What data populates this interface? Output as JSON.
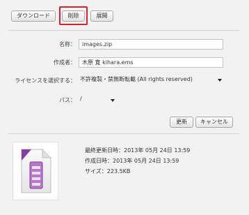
{
  "toolbar": {
    "download_label": "ダウンロード",
    "delete_label": "削除",
    "expand_label": "展開"
  },
  "form": {
    "name_label": "名称：",
    "name_value": "images.zip",
    "author_label": "作成者：",
    "author_value": "木原 寛 kihara.ems",
    "license_label": "ライセンスを選択する：",
    "license_value": "不許複製・禁無断転載 (All rights reserved)",
    "path_label": "パス：",
    "path_value": "/"
  },
  "actions": {
    "update_label": "更新",
    "cancel_label": "キャンセル"
  },
  "file_info": {
    "modified": "最終更新日時：2013年 05月 24日 13:59",
    "created": "作成日時：2013年 05月 24日 13:59",
    "size": "サイズ：223.5KB"
  },
  "colors": {
    "highlight": "#d9242b",
    "zip_icon_accent": "#8a3aa6"
  },
  "icons": {
    "file_thumbnail": "zip-archive-icon"
  }
}
